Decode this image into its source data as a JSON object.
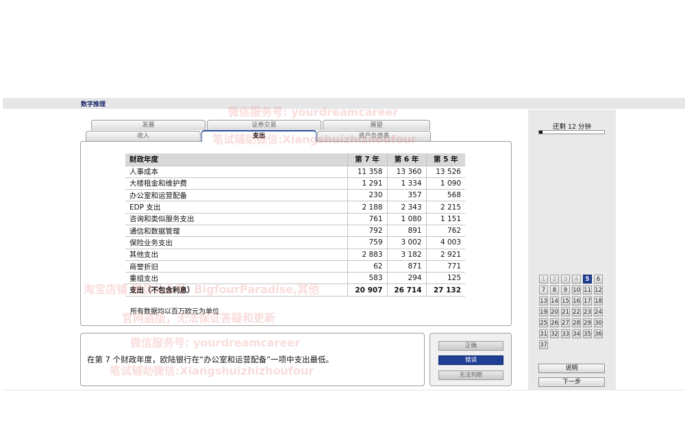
{
  "header": {
    "title": "数字推理"
  },
  "tabs": {
    "back_row": [
      "发展",
      "证券交易",
      "展望"
    ],
    "front_row": [
      "收入",
      "支出",
      "资产负债表"
    ],
    "active": "支出"
  },
  "table": {
    "columns": [
      "财政年度",
      "第 7 年",
      "第 6 年",
      "第 5 年"
    ],
    "rows": [
      {
        "label": "人事成本",
        "values": [
          "11 358",
          "13 360",
          "13 526"
        ]
      },
      {
        "label": "大楼租金和维护费",
        "values": [
          "1 291",
          "1 334",
          "1 090"
        ]
      },
      {
        "label": "办公室和运营配备",
        "values": [
          "230",
          "357",
          "568"
        ]
      },
      {
        "label": "EDP 支出",
        "values": [
          "2 188",
          "2 343",
          "2 215"
        ]
      },
      {
        "label": "咨询和类似服务支出",
        "values": [
          "761",
          "1 080",
          "1 151"
        ]
      },
      {
        "label": "通信和数据管理",
        "values": [
          "792",
          "891",
          "762"
        ]
      },
      {
        "label": "保险业务支出",
        "values": [
          "759",
          "3 002",
          "4 003"
        ]
      },
      {
        "label": "其他支出",
        "values": [
          "2 883",
          "3 182",
          "2 921"
        ]
      },
      {
        "label": "商誉折旧",
        "values": [
          "62",
          "871",
          "771"
        ]
      },
      {
        "label": "重组支出",
        "values": [
          "583",
          "294",
          "125"
        ]
      }
    ],
    "total": {
      "label": "支出（不包含利息）",
      "values": [
        "20 907",
        "26 714",
        "27 132"
      ]
    },
    "note": "所有数据均以百万欧元为单位"
  },
  "question": {
    "text": "在第 7 个财政年度，欧陆银行在“办公室和运营配备”一项中支出最低。"
  },
  "answers": {
    "options": [
      "正确",
      "错误",
      "无法判断"
    ],
    "selected": "错误"
  },
  "timer": {
    "text": "还剩 12 分钟",
    "progress": 0.05
  },
  "navigator": {
    "questions": [
      "1",
      "2",
      "3",
      "4",
      "5",
      "6",
      "7",
      "8",
      "9",
      "10",
      "11",
      "12",
      "13",
      "14",
      "15",
      "16",
      "17",
      "18",
      "19",
      "20",
      "21",
      "22",
      "23",
      "24",
      "25",
      "26",
      "27",
      "28",
      "29",
      "30",
      "31",
      "32",
      "33",
      "34",
      "35",
      "36",
      "37"
    ],
    "current": "5",
    "answered": [
      "1",
      "2",
      "3",
      "4"
    ]
  },
  "sidebar_buttons": {
    "explain": "说明",
    "next": "下一步"
  },
  "watermarks": [
    "微信服务号: yourdreamcareer",
    "笔试辅助微信:Xiangshuizhizhoufour",
    "淘宝店铺  微信公众号: BigfourParadise,其他",
    "官网盗版，无法保证答疑和更新",
    "微信服务号: yourdreamcareer",
    "笔试辅助微信:Xiangshuizhizhoufour"
  ],
  "colors": {
    "accent": "#1f3f95",
    "title": "#1b2a6b",
    "header_bg": "#d8d8d8"
  }
}
